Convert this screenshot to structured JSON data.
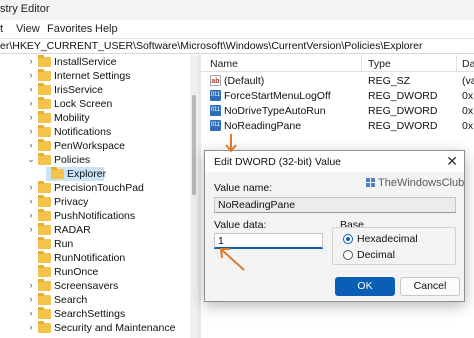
{
  "window": {
    "title": "stry Editor"
  },
  "menu": {
    "items": [
      "t",
      "View",
      "Favorites",
      "Help"
    ]
  },
  "address": {
    "path": "er\\HKEY_CURRENT_USER\\Software\\Microsoft\\Windows\\CurrentVersion\\Policies\\Explorer"
  },
  "tree": {
    "items": [
      {
        "label": "InstallService",
        "chevron": "›"
      },
      {
        "label": "Internet Settings",
        "chevron": "›"
      },
      {
        "label": "IrisService",
        "chevron": "›"
      },
      {
        "label": "Lock Screen",
        "chevron": "›"
      },
      {
        "label": "Mobility",
        "chevron": "›"
      },
      {
        "label": "Notifications",
        "chevron": "›"
      },
      {
        "label": "PenWorkspace",
        "chevron": "›"
      },
      {
        "label": "Policies",
        "chevron": "⌄"
      },
      {
        "label": "Explorer",
        "chevron": ""
      },
      {
        "label": "PrecisionTouchPad",
        "chevron": "›"
      },
      {
        "label": "Privacy",
        "chevron": "›"
      },
      {
        "label": "PushNotifications",
        "chevron": "›"
      },
      {
        "label": "RADAR",
        "chevron": "›"
      },
      {
        "label": "Run",
        "chevron": ""
      },
      {
        "label": "RunNotification",
        "chevron": ""
      },
      {
        "label": "RunOnce",
        "chevron": ""
      },
      {
        "label": "Screensavers",
        "chevron": "›"
      },
      {
        "label": "Search",
        "chevron": "›"
      },
      {
        "label": "SearchSettings",
        "chevron": "›"
      },
      {
        "label": "Security and Maintenance",
        "chevron": "›"
      }
    ]
  },
  "list": {
    "columns": {
      "name": "Name",
      "type": "Type",
      "data": "Da"
    },
    "rows": [
      {
        "icon": "ab",
        "name": "(Default)",
        "type": "REG_SZ",
        "data": "(va"
      },
      {
        "icon": "011",
        "name": "ForceStartMenuLogOff",
        "type": "REG_DWORD",
        "data": "0x"
      },
      {
        "icon": "011",
        "name": "NoDriveTypeAutoRun",
        "type": "REG_DWORD",
        "data": "0x"
      },
      {
        "icon": "011",
        "name": "NoReadingPane",
        "type": "REG_DWORD",
        "data": "0x"
      }
    ]
  },
  "dialog": {
    "title": "Edit DWORD (32-bit) Value",
    "close_glyph": "✕",
    "value_name_label": "Value name:",
    "value_name": "NoReadingPane",
    "value_data_label": "Value data:",
    "value_data": "1",
    "base_label": "Base",
    "hex_label": "Hexadecimal",
    "dec_label": "Decimal",
    "hex_selected": true,
    "ok_label": "OK",
    "cancel_label": "Cancel"
  },
  "watermark": {
    "text": "TheWindowsClub"
  },
  "colors": {
    "accent": "#0a5fb4",
    "arrow": "#e07a2e",
    "folder": "#f4c34c",
    "selection": "#cce4f7"
  }
}
